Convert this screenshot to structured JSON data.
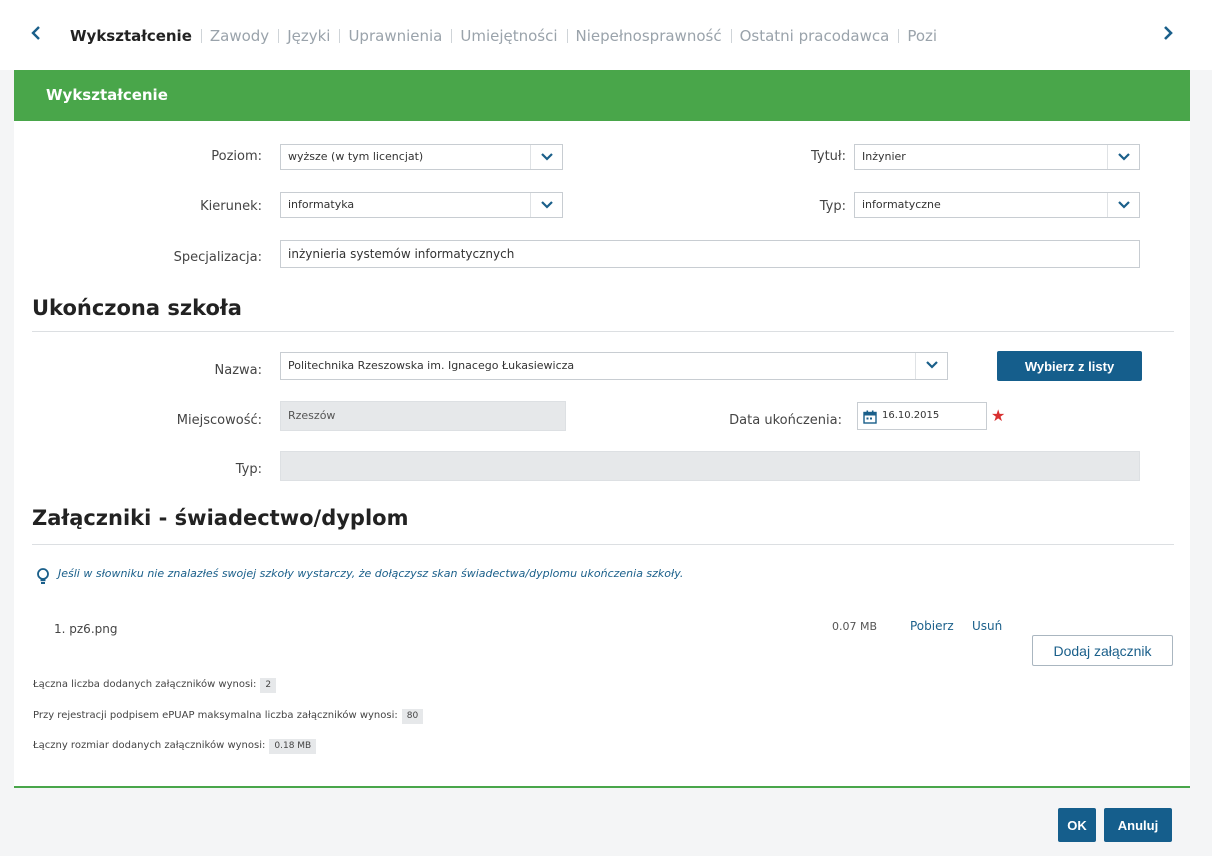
{
  "tabs": {
    "items": [
      "Wykształcenie",
      "Zawody",
      "Języki",
      "Uprawnienia",
      "Umiejętności",
      "Niepełnosprawność",
      "Ostatni pracodawca",
      "Pozi"
    ],
    "active": "Wykształcenie"
  },
  "panel": {
    "title": "Wykształcenie"
  },
  "education": {
    "poziom_label": "Poziom:",
    "poziom_value": "wyższe (w tym licencjat)",
    "tytul_label": "Tytuł:",
    "tytul_value": "Inżynier",
    "kierunek_label": "Kierunek:",
    "kierunek_value": "informatyka",
    "typ_label": "Typ:",
    "typ_value": "informatyczne",
    "specjalizacja_label": "Specjalizacja:",
    "specjalizacja_value": "inżynieria systemów informatycznych"
  },
  "school": {
    "section_title": "Ukończona szkoła",
    "nazwa_label": "Nazwa:",
    "nazwa_value": "Politechnika Rzeszowska im. Ignacego Łukasiewicza",
    "choose_button": "Wybierz z listy",
    "miejscowosc_label": "Miejscowość:",
    "miejscowosc_value": "Rzeszów",
    "data_label": "Data ukończenia:",
    "data_value": "16.10.2015",
    "typ_label": "Typ:",
    "typ_value": ""
  },
  "attachments": {
    "section_title": "Załączniki - świadectwo/dyplom",
    "info_text": "Jeśli w słowniku nie znalazłeś swojej szkoły wystarczy, że dołączysz skan świadectwa/dyplomu ukończenia szkoły.",
    "files": [
      {
        "name": "1. pz6.png",
        "size": "0.07 MB",
        "download": "Pobierz",
        "delete": "Usuń"
      }
    ],
    "add_button": "Dodaj załącznik",
    "count_label": "Łączna liczba dodanych załączników wynosi:",
    "count_value": "2",
    "max_label": "Przy rejestracji podpisem ePUAP maksymalna liczba załączników wynosi:",
    "max_value": "80",
    "size_label": "Łączny rozmiar dodanych załączników wynosi:",
    "size_value": "0.18 MB"
  },
  "footer": {
    "ok": "OK",
    "cancel": "Anuluj"
  },
  "colors": {
    "green": "#49a64a",
    "blue": "#155e8c",
    "required": "#d83030"
  },
  "icons": {
    "prev": "chevron-left-icon",
    "next": "chevron-right-icon",
    "dropdown": "chevron-down-icon",
    "calendar": "calendar-icon",
    "info": "lightbulb-icon",
    "required": "asterisk-icon"
  }
}
